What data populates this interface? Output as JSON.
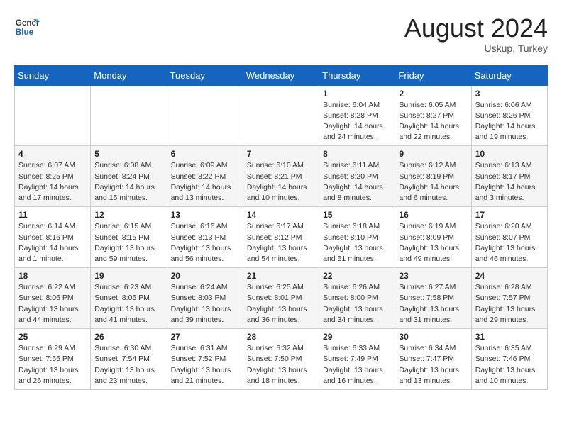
{
  "header": {
    "logo_line1": "General",
    "logo_line2": "Blue",
    "month_year": "August 2024",
    "location": "Uskup, Turkey"
  },
  "days_of_week": [
    "Sunday",
    "Monday",
    "Tuesday",
    "Wednesday",
    "Thursday",
    "Friday",
    "Saturday"
  ],
  "weeks": [
    [
      {
        "day": "",
        "info": ""
      },
      {
        "day": "",
        "info": ""
      },
      {
        "day": "",
        "info": ""
      },
      {
        "day": "",
        "info": ""
      },
      {
        "day": "1",
        "info": "Sunrise: 6:04 AM\nSunset: 8:28 PM\nDaylight: 14 hours and 24 minutes."
      },
      {
        "day": "2",
        "info": "Sunrise: 6:05 AM\nSunset: 8:27 PM\nDaylight: 14 hours and 22 minutes."
      },
      {
        "day": "3",
        "info": "Sunrise: 6:06 AM\nSunset: 8:26 PM\nDaylight: 14 hours and 19 minutes."
      }
    ],
    [
      {
        "day": "4",
        "info": "Sunrise: 6:07 AM\nSunset: 8:25 PM\nDaylight: 14 hours and 17 minutes."
      },
      {
        "day": "5",
        "info": "Sunrise: 6:08 AM\nSunset: 8:24 PM\nDaylight: 14 hours and 15 minutes."
      },
      {
        "day": "6",
        "info": "Sunrise: 6:09 AM\nSunset: 8:22 PM\nDaylight: 14 hours and 13 minutes."
      },
      {
        "day": "7",
        "info": "Sunrise: 6:10 AM\nSunset: 8:21 PM\nDaylight: 14 hours and 10 minutes."
      },
      {
        "day": "8",
        "info": "Sunrise: 6:11 AM\nSunset: 8:20 PM\nDaylight: 14 hours and 8 minutes."
      },
      {
        "day": "9",
        "info": "Sunrise: 6:12 AM\nSunset: 8:19 PM\nDaylight: 14 hours and 6 minutes."
      },
      {
        "day": "10",
        "info": "Sunrise: 6:13 AM\nSunset: 8:17 PM\nDaylight: 14 hours and 3 minutes."
      }
    ],
    [
      {
        "day": "11",
        "info": "Sunrise: 6:14 AM\nSunset: 8:16 PM\nDaylight: 14 hours and 1 minute."
      },
      {
        "day": "12",
        "info": "Sunrise: 6:15 AM\nSunset: 8:15 PM\nDaylight: 13 hours and 59 minutes."
      },
      {
        "day": "13",
        "info": "Sunrise: 6:16 AM\nSunset: 8:13 PM\nDaylight: 13 hours and 56 minutes."
      },
      {
        "day": "14",
        "info": "Sunrise: 6:17 AM\nSunset: 8:12 PM\nDaylight: 13 hours and 54 minutes."
      },
      {
        "day": "15",
        "info": "Sunrise: 6:18 AM\nSunset: 8:10 PM\nDaylight: 13 hours and 51 minutes."
      },
      {
        "day": "16",
        "info": "Sunrise: 6:19 AM\nSunset: 8:09 PM\nDaylight: 13 hours and 49 minutes."
      },
      {
        "day": "17",
        "info": "Sunrise: 6:20 AM\nSunset: 8:07 PM\nDaylight: 13 hours and 46 minutes."
      }
    ],
    [
      {
        "day": "18",
        "info": "Sunrise: 6:22 AM\nSunset: 8:06 PM\nDaylight: 13 hours and 44 minutes."
      },
      {
        "day": "19",
        "info": "Sunrise: 6:23 AM\nSunset: 8:05 PM\nDaylight: 13 hours and 41 minutes."
      },
      {
        "day": "20",
        "info": "Sunrise: 6:24 AM\nSunset: 8:03 PM\nDaylight: 13 hours and 39 minutes."
      },
      {
        "day": "21",
        "info": "Sunrise: 6:25 AM\nSunset: 8:01 PM\nDaylight: 13 hours and 36 minutes."
      },
      {
        "day": "22",
        "info": "Sunrise: 6:26 AM\nSunset: 8:00 PM\nDaylight: 13 hours and 34 minutes."
      },
      {
        "day": "23",
        "info": "Sunrise: 6:27 AM\nSunset: 7:58 PM\nDaylight: 13 hours and 31 minutes."
      },
      {
        "day": "24",
        "info": "Sunrise: 6:28 AM\nSunset: 7:57 PM\nDaylight: 13 hours and 29 minutes."
      }
    ],
    [
      {
        "day": "25",
        "info": "Sunrise: 6:29 AM\nSunset: 7:55 PM\nDaylight: 13 hours and 26 minutes."
      },
      {
        "day": "26",
        "info": "Sunrise: 6:30 AM\nSunset: 7:54 PM\nDaylight: 13 hours and 23 minutes."
      },
      {
        "day": "27",
        "info": "Sunrise: 6:31 AM\nSunset: 7:52 PM\nDaylight: 13 hours and 21 minutes."
      },
      {
        "day": "28",
        "info": "Sunrise: 6:32 AM\nSunset: 7:50 PM\nDaylight: 13 hours and 18 minutes."
      },
      {
        "day": "29",
        "info": "Sunrise: 6:33 AM\nSunset: 7:49 PM\nDaylight: 13 hours and 16 minutes."
      },
      {
        "day": "30",
        "info": "Sunrise: 6:34 AM\nSunset: 7:47 PM\nDaylight: 13 hours and 13 minutes."
      },
      {
        "day": "31",
        "info": "Sunrise: 6:35 AM\nSunset: 7:46 PM\nDaylight: 13 hours and 10 minutes."
      }
    ]
  ]
}
